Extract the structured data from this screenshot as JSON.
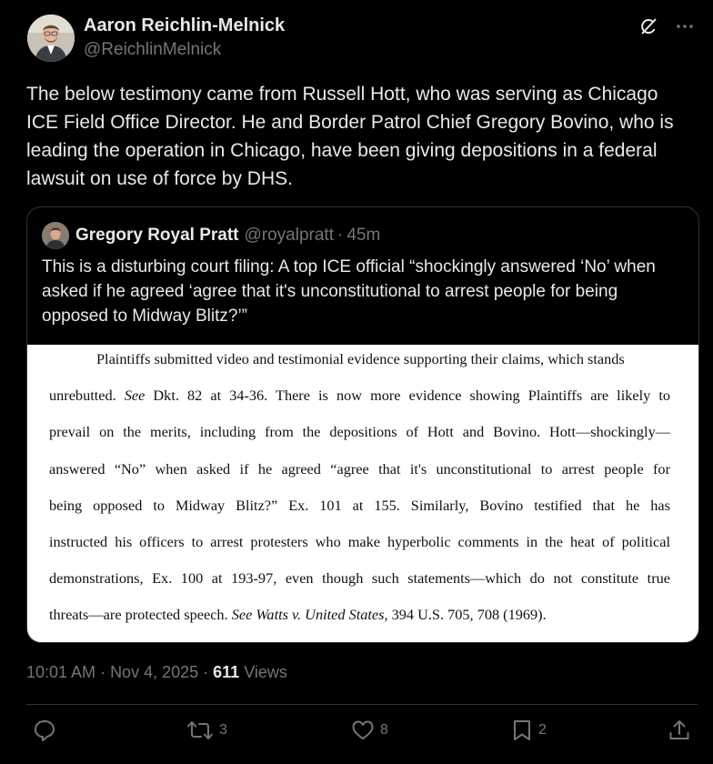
{
  "author": {
    "name": "Aaron Reichlin-Melnick",
    "handle": "@ReichlinMelnick"
  },
  "tweet_text": "The below testimony came from Russell Hott, who was serving as Chicago ICE Field Office Director. He and Border Patrol Chief Gregory Bovino, who is leading the operation in Chicago, have been giving depositions in a federal lawsuit on use of force by DHS.",
  "quote": {
    "name": "Gregory Royal Pratt",
    "handle": "@royalpratt",
    "separator": "·",
    "time": "45m",
    "text": "This is a disturbing court filing: A top ICE official “shockingly answered ‘No’ when asked if he agreed ‘agree that it's unconstitutional to arrest people for being opposed to Midway Blitz?’”",
    "document_lines": [
      "Plaintiffs submitted video and testimonial evidence supporting their claims, which stands",
      "unrebutted. See Dkt. 82 at 34-36. There is now more evidence showing Plaintiffs are likely to",
      "prevail on the merits, including from the depositions of Hott and Bovino. Hott—shockingly—",
      "answered “No” when asked if he agreed “agree that it's unconstitutional to arrest people for",
      "being opposed to Midway Blitz?” Ex. 101 at 155. Similarly, Bovino testified that he has",
      "instructed his officers to arrest protesters who make hyperbolic comments in the heat of political",
      "demonstrations, Ex. 100 at 193-97, even though such statements—which do not constitute true",
      "threats—are protected speech. See Watts v. United States, 394 U.S. 705, 708 (1969)."
    ]
  },
  "meta": {
    "time": "10:01 AM",
    "sep1": " · ",
    "date": "Nov 4, 2025",
    "sep2": " · ",
    "views_count": "611",
    "views_label": " Views"
  },
  "actions": {
    "reply_count": "",
    "repost_count": "3",
    "like_count": "8",
    "bookmark_count": "2"
  },
  "icons": [
    "grok-icon",
    "more-icon",
    "reply-icon",
    "repost-icon",
    "like-icon",
    "bookmark-icon",
    "share-icon"
  ]
}
